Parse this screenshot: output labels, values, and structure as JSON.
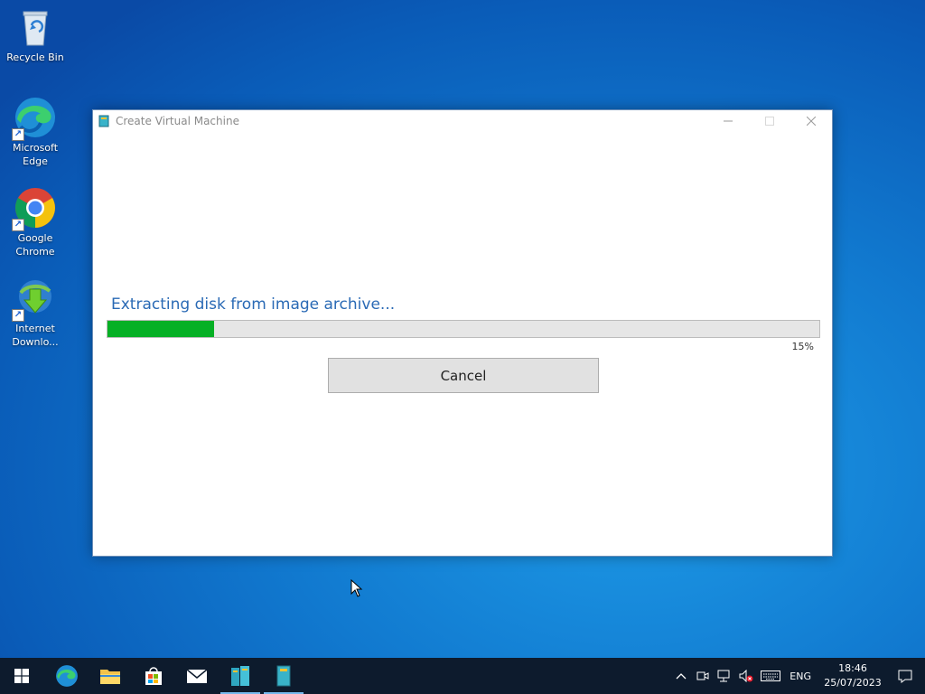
{
  "desktop": {
    "icons": [
      {
        "label": "Recycle Bin"
      },
      {
        "label": "Microsoft Edge"
      },
      {
        "label": "Google Chrome"
      },
      {
        "label": "Internet Downlo..."
      }
    ]
  },
  "window": {
    "title": "Create Virtual Machine",
    "status": "Extracting disk from image archive...",
    "progress": 0.15,
    "percent_text": "15%",
    "cancel_label": "Cancel",
    "colors": {
      "progress": "#06b025",
      "status_text": "#2a6ab5"
    }
  },
  "taskbar": {
    "apps": [
      "start-icon",
      "edge-icon",
      "file-explorer-icon",
      "store-icon",
      "mail-icon",
      "vm-manager-icon",
      "create-vm-icon"
    ],
    "language": "ENG",
    "time": "18:46",
    "date": "25/07/2023"
  }
}
